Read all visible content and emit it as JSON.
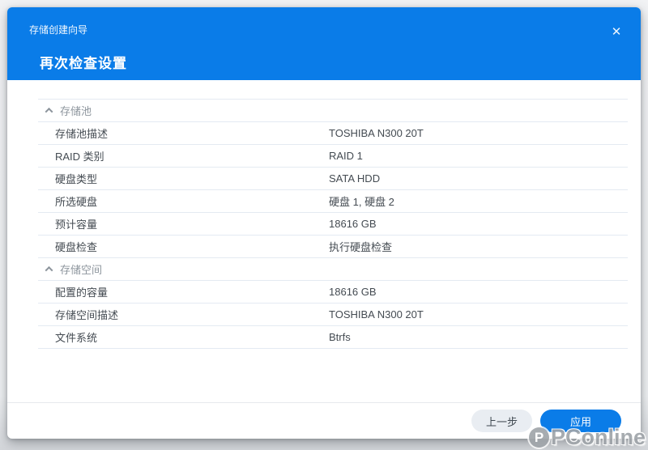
{
  "dialog": {
    "wizard_title": "存储创建向导",
    "step_title": "再次检查设置",
    "close_icon": "✕"
  },
  "summary": {
    "sections": [
      {
        "title": "存储池",
        "rows": [
          {
            "label": "存储池描述",
            "value": "TOSHIBA N300 20T"
          },
          {
            "label": "RAID 类别",
            "value": "RAID 1"
          },
          {
            "label": "硬盘类型",
            "value": "SATA HDD"
          },
          {
            "label": "所选硬盘",
            "value": "硬盘 1, 硬盘 2"
          },
          {
            "label": "预计容量",
            "value": "18616 GB"
          },
          {
            "label": "硬盘检查",
            "value": "执行硬盘检查"
          }
        ]
      },
      {
        "title": "存储空间",
        "rows": [
          {
            "label": "配置的容量",
            "value": "18616 GB"
          },
          {
            "label": "存储空间描述",
            "value": "TOSHIBA N300 20T"
          },
          {
            "label": "文件系统",
            "value": "Btrfs"
          }
        ]
      }
    ]
  },
  "footer": {
    "back_label": "上一步",
    "apply_label": "应用"
  },
  "watermark": {
    "logo_letter": "P",
    "text": "PConline"
  },
  "colors": {
    "accent_blue": "#0a7ce8",
    "divider": "#e4eaf2",
    "section_text": "#8d959d",
    "row_text": "#444b52"
  }
}
